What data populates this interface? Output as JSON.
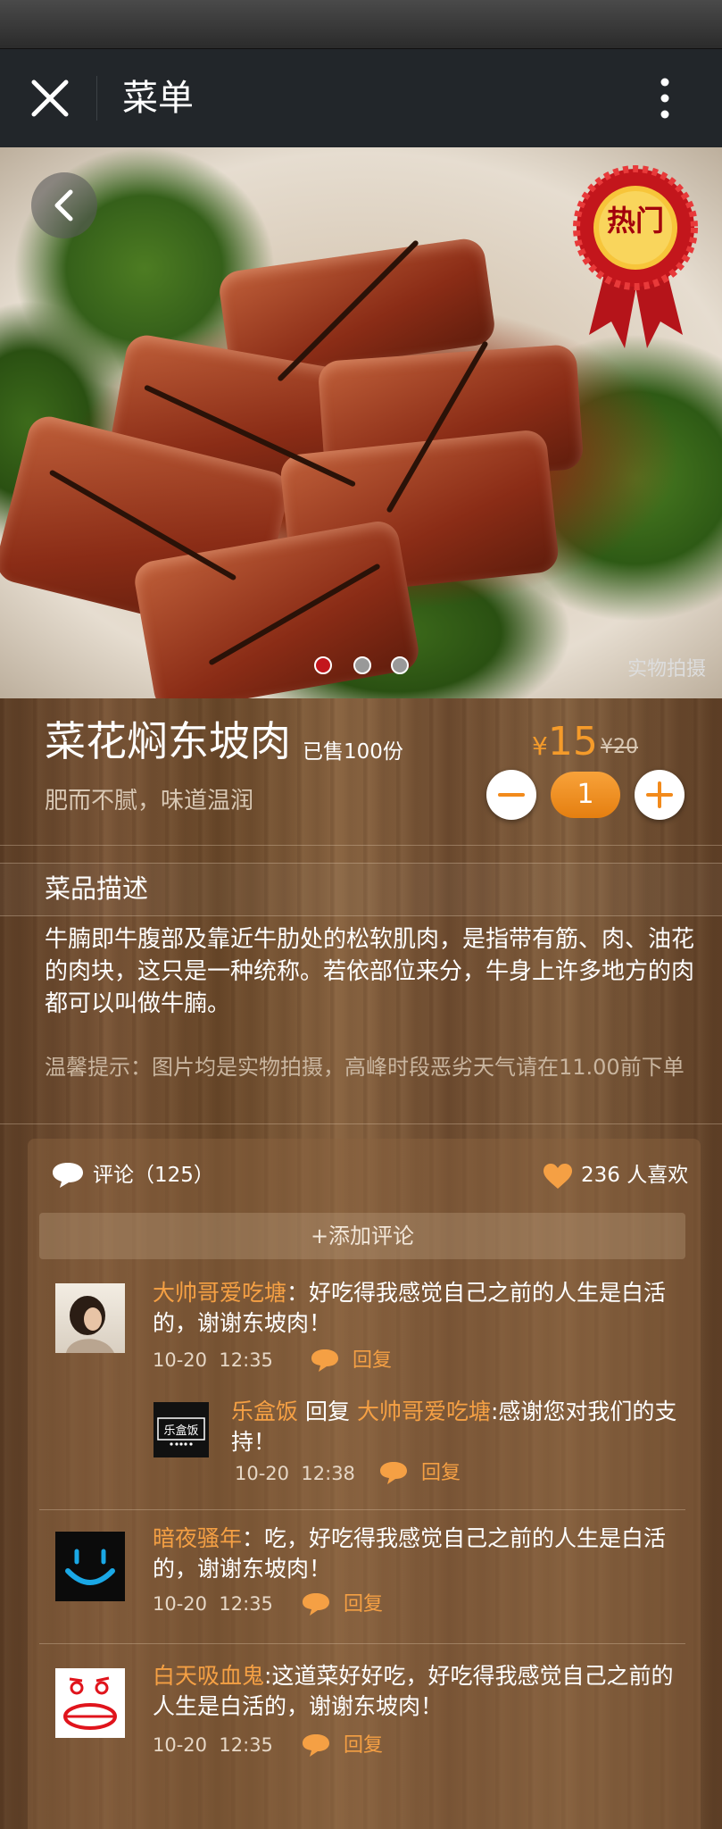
{
  "nav": {
    "title": "菜单"
  },
  "hero": {
    "badge": "热门",
    "photo_label": "实物拍摄"
  },
  "dish": {
    "name": "菜花焖东坡肉",
    "sold": "已售100份",
    "tagline": "肥而不腻，味道温润",
    "price_symbol": "¥",
    "price": "15",
    "original_price": "¥20",
    "quantity": "1"
  },
  "description": {
    "title": "菜品描述",
    "body": "牛腩即牛腹部及靠近牛肋处的松软肌肉，是指带有筋、肉、油花的肉块，这只是一种统称。若依部位来分，牛身上许多地方的肉都可以叫做牛腩。",
    "tip": "温馨提示：图片均是实物拍摄，高峰时段恶劣天气请在11.00前下单"
  },
  "comments": {
    "count_label": "评论（125）",
    "likes_label": "236 人喜欢",
    "add_label": "+添加评论",
    "reply_label": "回复",
    "reply_word": "回复",
    "items": [
      {
        "user": "大帅哥爱吃塘",
        "text": "：好吃得我感觉自己之前的人生是白活的，谢谢东坡肉！",
        "date": "10-20",
        "time": "12:35"
      },
      {
        "user": "乐盒饭",
        "reply_to": "大帅哥爱吃塘",
        "text": ":感谢您对我们的支持！",
        "date": "10-20",
        "time": "12:38"
      },
      {
        "user": "暗夜骚年",
        "text": "：吃，好吃得我感觉自己之前的人生是白活的，谢谢东坡肉！",
        "date": "10-20",
        "time": "12:35"
      },
      {
        "user": "白天吸血鬼",
        "text": ":这道菜好好吃，好吃得我感觉自己之前的人生是白活的，谢谢东坡肉！",
        "date": "10-20",
        "time": "12:35"
      }
    ],
    "avatar_logo_text": "乐盒饭"
  },
  "colors": {
    "accent": "#f5a044",
    "price": "#f59b2a",
    "nav": "#22262a",
    "badge_red": "#c3161c",
    "badge_gold": "#f7c53a"
  }
}
